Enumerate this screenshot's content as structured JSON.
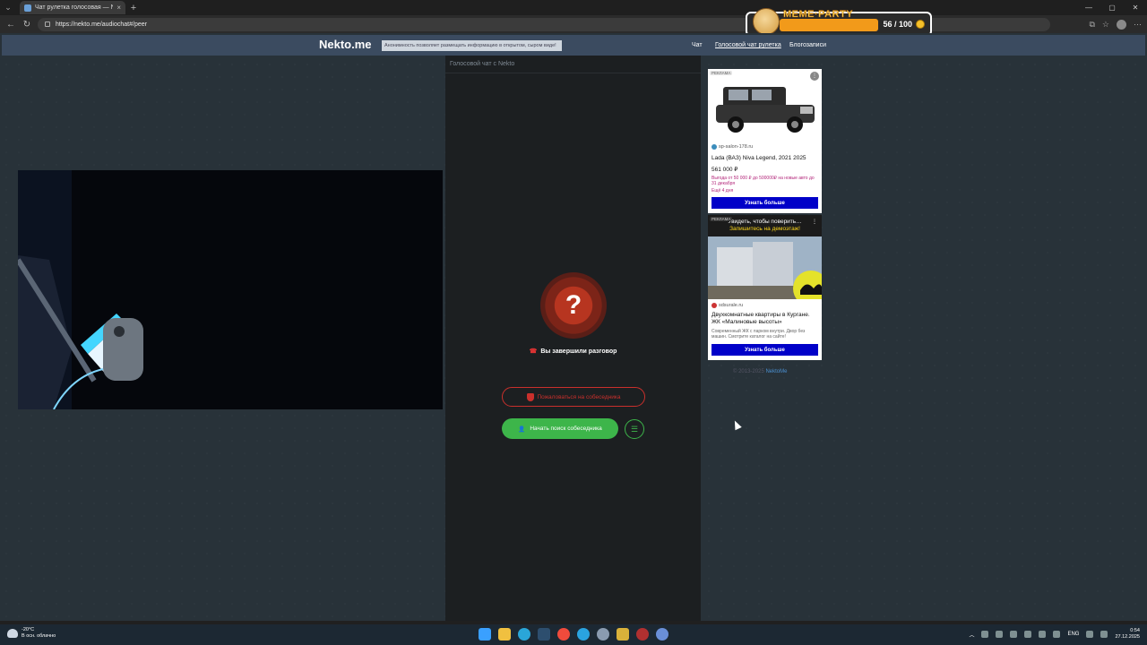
{
  "browser": {
    "tab_title": "Чат рулетка голосовая — Nekto",
    "tab_close": "×",
    "new_tab": "+",
    "url": "https://nekto.me/audiochat#/peer",
    "window_controls": [
      "—",
      "▢",
      "✕"
    ]
  },
  "overlay": {
    "label": "MEME·PARTY",
    "count": "56 / 100"
  },
  "site": {
    "logo": "Nekto.me",
    "notice": "Анонимность позволяет размещать информацию в открытом, сыром виде!",
    "nav": [
      "Чат",
      "Голосовой чат рулетка",
      "Блогозаписи"
    ]
  },
  "chat": {
    "header": "Голосовой чат с Nekto",
    "status_icon": "?",
    "ended_text": "Вы завершили разговор",
    "complain_label": "Пожаловаться на собеседника",
    "start_label": "Начать поиск собеседника"
  },
  "ads": [
    {
      "label": "РЕКЛАМА",
      "source": "sp-salon-178.ru",
      "title": "Lada (ВАЗ) Niva Legend, 2021 2025",
      "price": "561 000 ₽",
      "promo": "Выгода от 50 000 ₽ до 500000₽ на новые авто до 31 декабря",
      "promo2": "Ещё 4 дня",
      "button": "Узнать больше"
    },
    {
      "label": "РЕКЛАМА",
      "headline1": "Увидеть, чтобы поверить…",
      "headline2": "Запишитесь на демоэтаж!",
      "source": "sdsurale.ru",
      "title": "Двухкомнатные квартиры в Кургане. ЖК «Малиновые высоты»",
      "description": "Современный ЖК с парком внутри. Двор без машин. Смотрите каталог на сайте!",
      "button": "Узнать больше"
    }
  ],
  "footer": {
    "copyright": "© 2013-2025",
    "link": "NektoMe"
  },
  "taskbar": {
    "temp": "-20°C",
    "weather": "В осн. облачно",
    "lang": "ENG",
    "time": "0:54",
    "date": "27.12.2025"
  },
  "colors": {
    "accent_green": "#3db54a",
    "accent_red": "#c9302c",
    "ad_button": "#0000c8",
    "header_bg": "#3b4b60"
  }
}
